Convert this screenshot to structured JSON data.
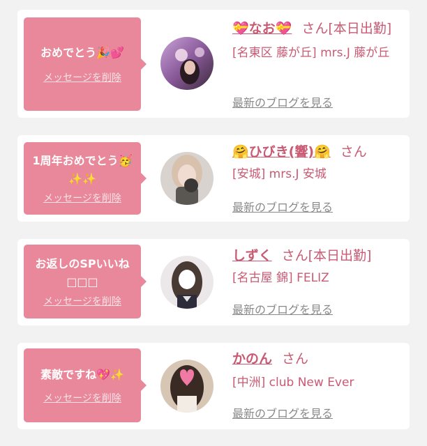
{
  "cards": [
    {
      "message": "おめでとう🎉💕",
      "delete_label": "メッセージを削除",
      "name": "💝なお💝",
      "san": "さん",
      "status": "[本日出勤]",
      "shop": "[名東区 藤が丘] mrs.J 藤が丘",
      "blog_label": "最新のブログを見る"
    },
    {
      "message": "1周年おめでとう🥳✨✨",
      "delete_label": "メッセージを削除",
      "name": "🤗ひびき(響)🤗",
      "san": "さん",
      "status": "",
      "shop": "[安城] mrs.J 安城",
      "blog_label": "最新のブログを見る"
    },
    {
      "message": "お返しのSPいいね□□□",
      "delete_label": "メッセージを削除",
      "name": "しずく",
      "san": "さん",
      "status": "[本日出勤]",
      "shop": "[名古屋 錦] FELIZ",
      "blog_label": "最新のブログを見る"
    },
    {
      "message": "素敵ですね💖✨",
      "delete_label": "メッセージを削除",
      "name": "かのん",
      "san": "さん",
      "status": "",
      "shop": "[中洲] club New Ever",
      "blog_label": "最新のブログを見る"
    }
  ],
  "colors": {
    "accent": "#e8889a",
    "name_text": "#c95a73",
    "link_gray": "#8a8a8a",
    "background": "#f2f2f2",
    "card": "#ffffff"
  }
}
